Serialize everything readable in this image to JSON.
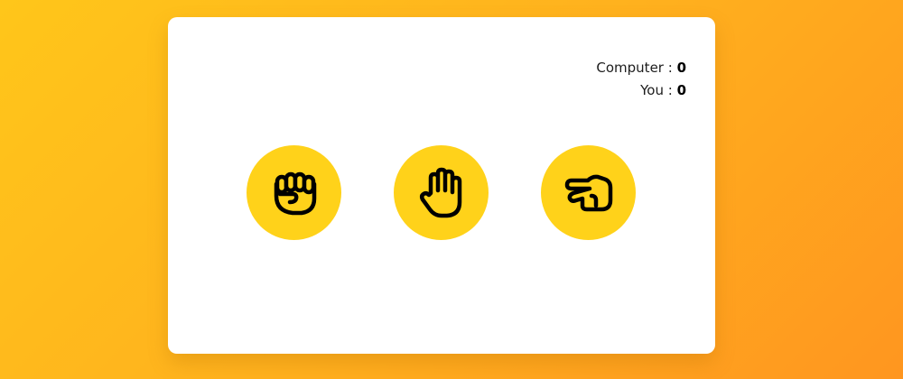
{
  "score": {
    "computer_label": "Computer : ",
    "computer_value": "0",
    "you_label": "You : ",
    "you_value": "0"
  },
  "choices": [
    {
      "name": "rock",
      "icon": "fist-icon"
    },
    {
      "name": "paper",
      "icon": "open-hand-icon"
    },
    {
      "name": "scissors",
      "icon": "scissors-hand-icon"
    }
  ],
  "colors": {
    "background_start": "#ffc61a",
    "background_end": "#ff961f",
    "card": "#ffffff",
    "choice_circle": "#ffd21a",
    "icon_fill": "#ffd21a",
    "icon_stroke": "#000000"
  }
}
